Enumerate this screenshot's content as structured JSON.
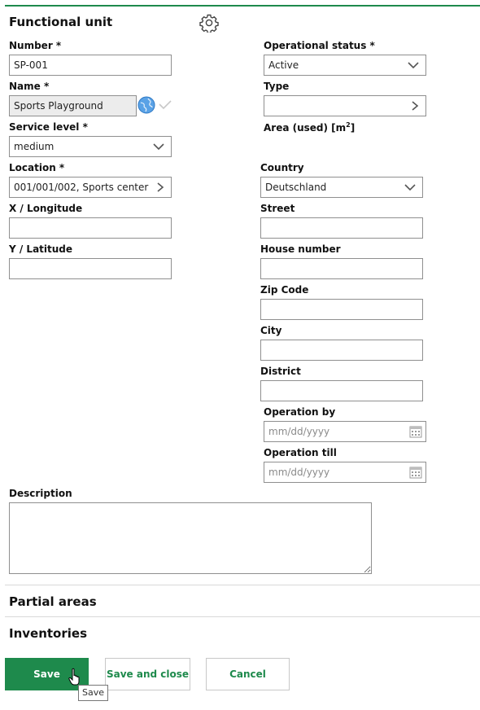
{
  "header": {
    "title": "Functional unit",
    "settings_icon": "gear-icon"
  },
  "left": {
    "number": {
      "label": "Number *",
      "value": "SP-001"
    },
    "name": {
      "label": "Name *",
      "value": "Sports Playground",
      "icons": [
        "globe-icon",
        "check-icon"
      ]
    },
    "service_level": {
      "label": "Service level *",
      "value": "medium"
    },
    "location": {
      "label": "Location *",
      "value": "001/001/002, Sports center"
    },
    "x_longitude": {
      "label": "X / Longitude",
      "value": ""
    },
    "y_latitude": {
      "label": "Y / Latitude",
      "value": ""
    }
  },
  "right": {
    "operational_status": {
      "label": "Operational status *",
      "value": "Active"
    },
    "type": {
      "label": "Type",
      "value": ""
    },
    "area": {
      "label": "Area (used) [m",
      "sup": "2",
      "tail": "]"
    },
    "country": {
      "label": "Country",
      "value": "Deutschland"
    },
    "street": {
      "label": "Street",
      "value": ""
    },
    "house_number": {
      "label": "House number",
      "value": ""
    },
    "zip_code": {
      "label": "Zip Code",
      "value": ""
    },
    "city": {
      "label": "City",
      "value": ""
    },
    "district": {
      "label": "District",
      "value": ""
    },
    "operation_by": {
      "label": "Operation by",
      "placeholder": "mm/dd/yyyy"
    },
    "operation_till": {
      "label": "Operation till",
      "placeholder": "mm/dd/yyyy"
    }
  },
  "description": {
    "label": "Description",
    "value": ""
  },
  "sections": {
    "partial_areas": "Partial areas",
    "inventories": "Inventories"
  },
  "buttons": {
    "save": "Save",
    "save_and_close": "Save and close",
    "cancel": "Cancel"
  },
  "tooltip": {
    "text": "Save"
  },
  "colors": {
    "accent": "#1e8a4c",
    "border": "#8f8f8f",
    "readonly_bg": "#ececec"
  }
}
